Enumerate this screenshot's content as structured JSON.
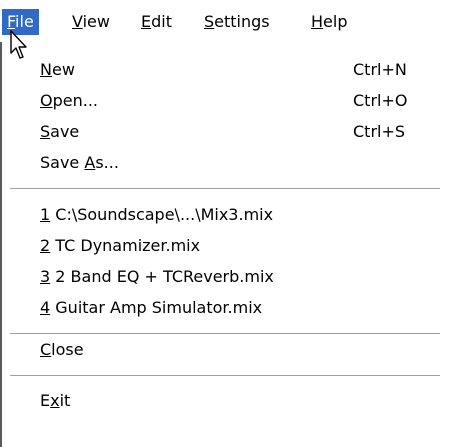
{
  "menubar": {
    "items": [
      {
        "pre": "",
        "key": "F",
        "post": "ile"
      },
      {
        "pre": "",
        "key": "V",
        "post": "iew"
      },
      {
        "pre": "",
        "key": "E",
        "post": "dit"
      },
      {
        "pre": "",
        "key": "S",
        "post": "ettings"
      },
      {
        "pre": "",
        "key": "H",
        "post": "elp"
      }
    ],
    "active_color": "#316ac5"
  },
  "file_menu": {
    "new": {
      "pre": "",
      "key": "N",
      "post": "ew",
      "shortcut": "Ctrl+N"
    },
    "open": {
      "pre": "",
      "key": "O",
      "post": "pen...",
      "shortcut": "Ctrl+O"
    },
    "save": {
      "pre": "",
      "key": "S",
      "post": "ave",
      "shortcut": "Ctrl+S"
    },
    "save_as": {
      "pre": "Save ",
      "key": "A",
      "post": "s..."
    },
    "recent": [
      {
        "key": "1",
        "post": " C:\\Soundscape\\...\\Mix3.mix"
      },
      {
        "key": "2",
        "post": " TC Dynamizer.mix"
      },
      {
        "key": "3",
        "post": " 2 Band EQ + TCReverb.mix"
      },
      {
        "key": "4",
        "post": " Guitar Amp Simulator.mix"
      }
    ],
    "close": {
      "pre": "",
      "key": "C",
      "post": "lose"
    },
    "exit": {
      "pre": "E",
      "key": "x",
      "post": "it"
    }
  },
  "cursor_icon": "arrow-pointer-icon"
}
